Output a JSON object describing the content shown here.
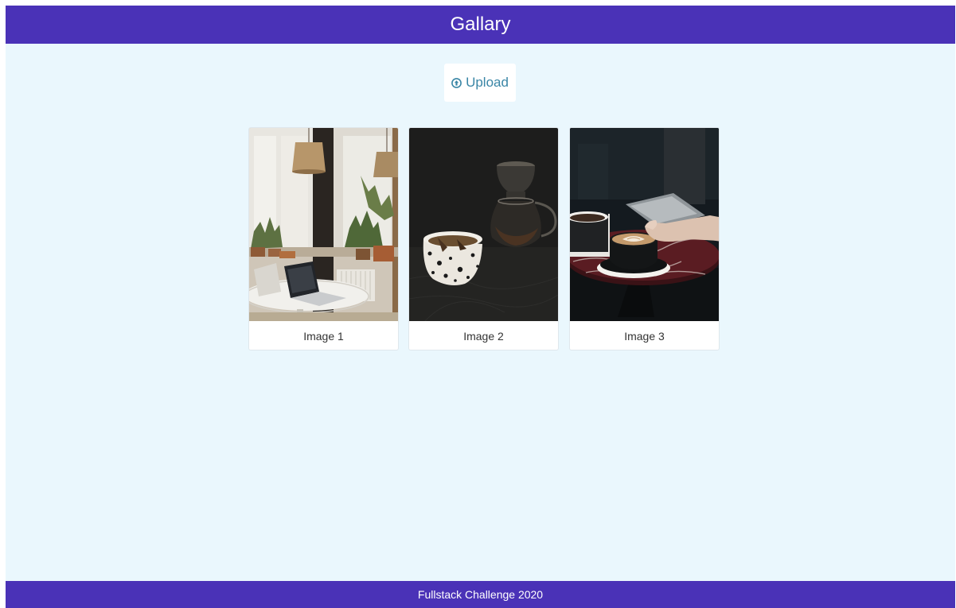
{
  "header": {
    "title": "Gallary"
  },
  "toolbar": {
    "upload_label": "Upload",
    "upload_icon": "upload-circle-icon"
  },
  "gallery": {
    "items": [
      {
        "caption": "Image 1"
      },
      {
        "caption": "Image 2"
      },
      {
        "caption": "Image 3"
      }
    ]
  },
  "footer": {
    "text": "Fullstack Challenge 2020"
  },
  "colors": {
    "brand": "#4a32b7",
    "background": "#eaf7fd",
    "accent": "#3a86a6"
  }
}
